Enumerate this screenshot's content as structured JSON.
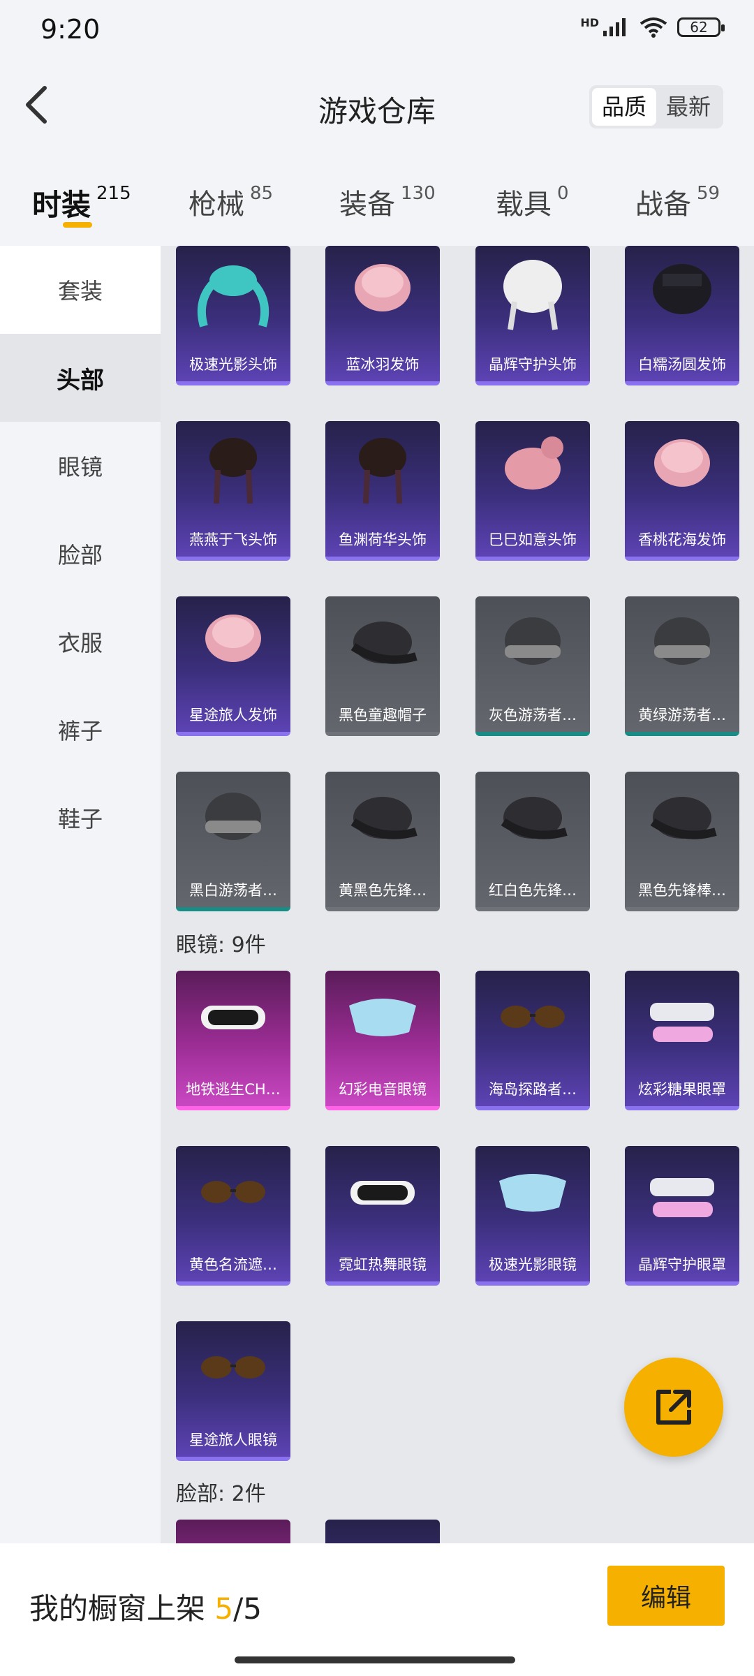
{
  "status_bar": {
    "time": "9:20",
    "network": "HD",
    "battery": "62"
  },
  "header": {
    "title": "游戏仓库",
    "sort_options": [
      "品质",
      "最新"
    ],
    "sort_selected": "品质"
  },
  "tabs": [
    {
      "label": "时装",
      "count": "215",
      "active": true
    },
    {
      "label": "枪械",
      "count": "85"
    },
    {
      "label": "装备",
      "count": "130"
    },
    {
      "label": "载具",
      "count": "0"
    },
    {
      "label": "战备",
      "count": "59"
    }
  ],
  "sidebar": [
    {
      "label": "套装"
    },
    {
      "label": "头部",
      "active": true
    },
    {
      "label": "眼镜"
    },
    {
      "label": "脸部"
    },
    {
      "label": "衣服"
    },
    {
      "label": "裤子"
    },
    {
      "label": "鞋子"
    }
  ],
  "head_items": [
    {
      "name": "极速光影头饰",
      "rarity": "purple",
      "art": "twin-tail-wig-icon"
    },
    {
      "name": "蓝冰羽发饰",
      "rarity": "purple",
      "art": "pink-hair-icon"
    },
    {
      "name": "晶辉守护头饰",
      "rarity": "purple",
      "art": "white-hair-icon"
    },
    {
      "name": "白糯汤圆发饰",
      "rarity": "purple",
      "art": "black-bob-hair-icon"
    },
    {
      "name": "燕燕于飞头饰",
      "rarity": "purple",
      "art": "braid-hair-icon"
    },
    {
      "name": "鱼渊荷华头饰",
      "rarity": "purple",
      "art": "braid-hair-icon"
    },
    {
      "name": "巳巳如意头饰",
      "rarity": "purple",
      "art": "bun-hair-icon"
    },
    {
      "name": "香桃花海发饰",
      "rarity": "purple",
      "art": "pink-hair-icon"
    },
    {
      "name": "星途旅人发饰",
      "rarity": "purple",
      "art": "pink-hair-icon"
    },
    {
      "name": "黑色童趣帽子",
      "rarity": "gray",
      "art": "cap-icon"
    },
    {
      "name": "灰色游荡者…",
      "rarity": "gray-teal",
      "art": "beanie-icon"
    },
    {
      "name": "黄绿游荡者…",
      "rarity": "gray-teal",
      "art": "beanie-icon"
    },
    {
      "name": "黑白游荡者…",
      "rarity": "gray-teal",
      "art": "beanie-icon"
    },
    {
      "name": "黄黑色先锋…",
      "rarity": "gray",
      "art": "cap-icon"
    },
    {
      "name": "红白色先锋…",
      "rarity": "gray",
      "art": "cap-icon"
    },
    {
      "name": "黑色先锋棒…",
      "rarity": "gray",
      "art": "cap-icon"
    }
  ],
  "glasses_heading": "眼镜: 9件",
  "glasses_items": [
    {
      "name": "地铁逃生CH…",
      "rarity": "pink",
      "art": "goggles-icon"
    },
    {
      "name": "幻彩电音眼镜",
      "rarity": "pink",
      "art": "visor-icon"
    },
    {
      "name": "海岛探路者…",
      "rarity": "purple",
      "art": "sunglasses-icon"
    },
    {
      "name": "炫彩糖果眼罩",
      "rarity": "purple",
      "art": "eye-mask-icon"
    },
    {
      "name": "黄色名流遮…",
      "rarity": "purple",
      "art": "sunglasses-icon"
    },
    {
      "name": "霓虹热舞眼镜",
      "rarity": "purple",
      "art": "goggles-icon"
    },
    {
      "name": "极速光影眼镜",
      "rarity": "purple",
      "art": "visor-icon"
    },
    {
      "name": "晶辉守护眼罩",
      "rarity": "purple",
      "art": "eye-mask-icon"
    },
    {
      "name": "星途旅人眼镜",
      "rarity": "purple",
      "art": "sunglasses-icon"
    }
  ],
  "face_heading": "脸部: 2件",
  "face_items": [
    {
      "rarity": "pink"
    },
    {
      "rarity": "purple"
    }
  ],
  "bottom_bar": {
    "label": "我的橱窗上架",
    "current": "5",
    "separator": "/",
    "total": "5",
    "edit_label": "编辑"
  },
  "colors": {
    "accent": "#f5b000",
    "purple_card": "#3b2f7c",
    "gray_card": "#5a5c64",
    "pink_card": "#9c2d95"
  }
}
